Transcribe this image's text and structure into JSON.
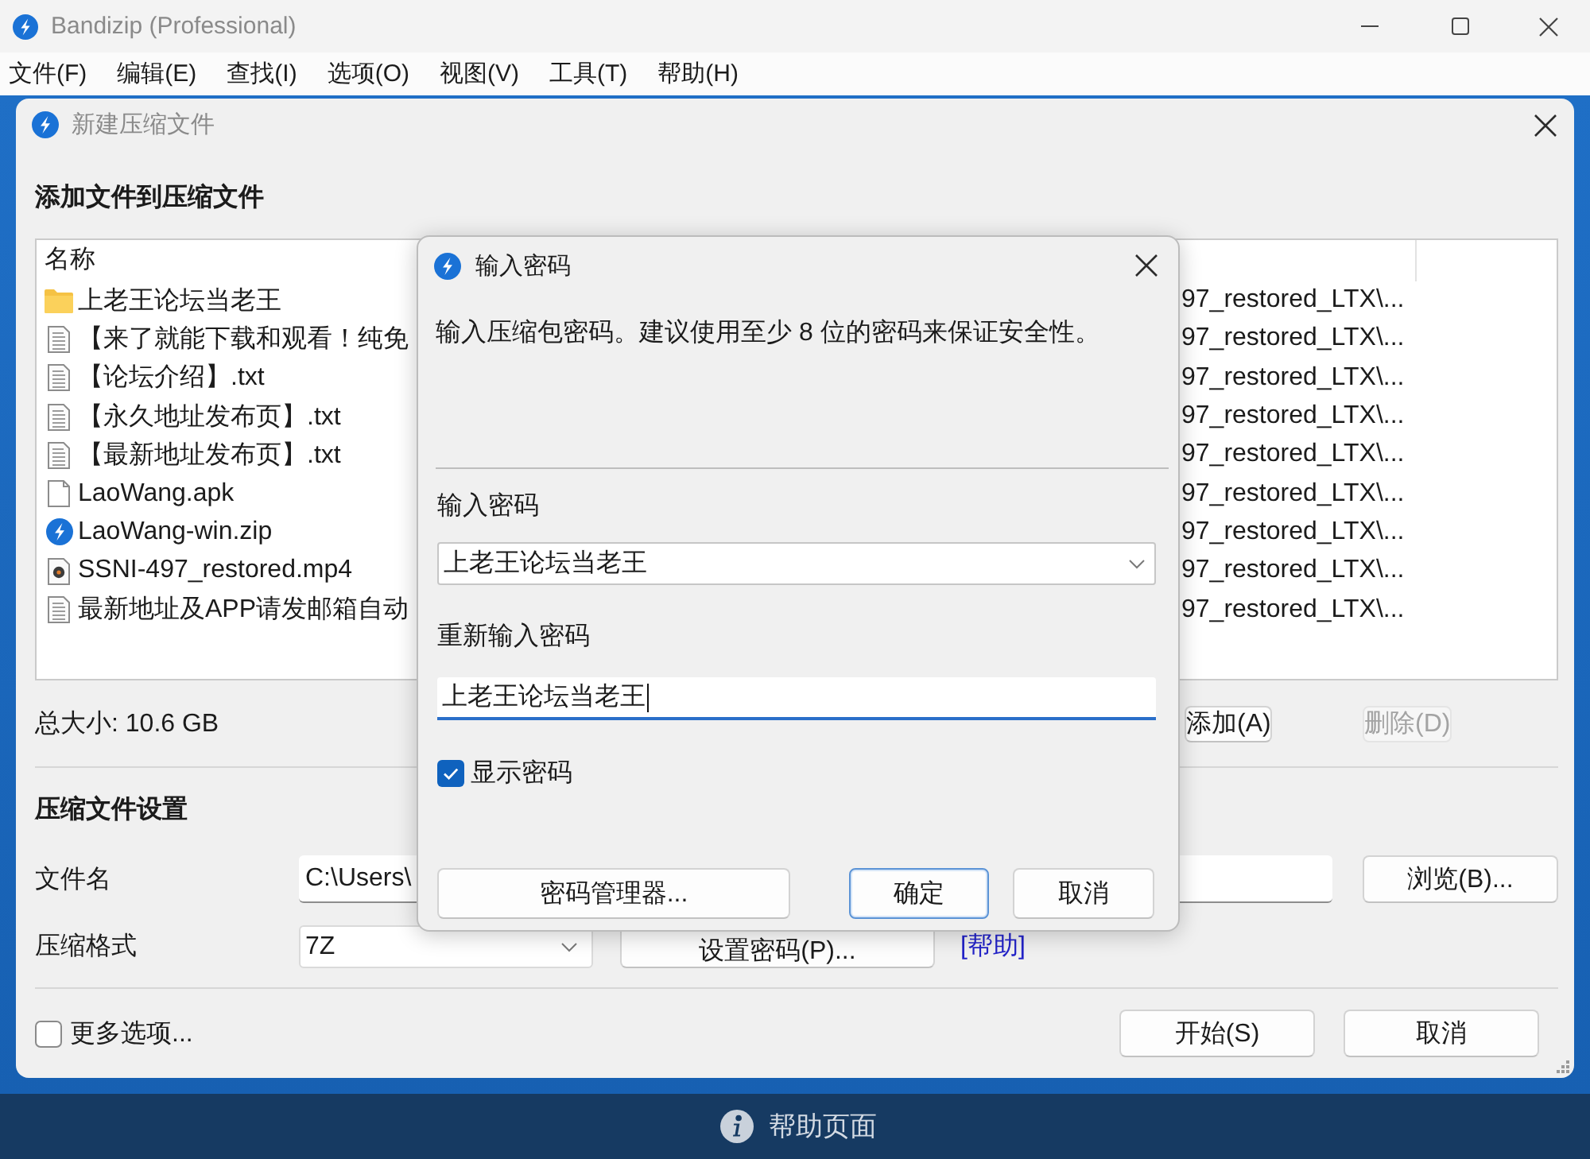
{
  "window": {
    "title": "Bandizip (Professional)"
  },
  "menu_bar": [
    "文件(F)",
    "编辑(E)",
    "查找(I)",
    "选项(O)",
    "视图(V)",
    "工具(T)",
    "帮助(H)"
  ],
  "new_archive_dialog": {
    "title": "新建压缩文件",
    "add_files_heading": "添加文件到压缩文件",
    "file_list": {
      "columns": [
        "名称"
      ],
      "rows": [
        {
          "kind": "folder",
          "name": "上老王论坛当老王",
          "column_2": "97_restored_LTX\\..."
        },
        {
          "kind": "text",
          "name": "【来了就能下载和观看！纯免",
          "column_2": "97_restored_LTX\\..."
        },
        {
          "kind": "text",
          "name": "【论坛介绍】.txt",
          "column_2": "97_restored_LTX\\..."
        },
        {
          "kind": "text",
          "name": "【永久地址发布页】.txt",
          "column_2": "97_restored_LTX\\..."
        },
        {
          "kind": "text",
          "name": "【最新地址发布页】.txt",
          "column_2": "97_restored_LTX\\..."
        },
        {
          "kind": "file",
          "name": "LaoWang.apk",
          "column_2": "97_restored_LTX\\..."
        },
        {
          "kind": "archive",
          "name": "LaoWang-win.zip",
          "column_2": "97_restored_LTX\\..."
        },
        {
          "kind": "video",
          "name": "SSNI-497_restored.mp4",
          "column_2": "97_restored_LTX\\..."
        },
        {
          "kind": "text",
          "name": "最新地址及APP请发邮箱自动",
          "column_2": "97_restored_LTX\\..."
        }
      ]
    },
    "total_size": "总大小: 10.6 GB",
    "add_button": {
      "label": "添加(A)",
      "disabled": false
    },
    "delete_button": {
      "label": "删除(D)",
      "disabled": true
    },
    "settings_heading": "压缩文件设置",
    "file_name": {
      "label": "文件名",
      "value": "C:\\Users\\"
    },
    "browse_button": "浏览(B)...",
    "format": {
      "label": "压缩格式",
      "value": "7Z"
    },
    "set_password_button": "设置密码(P)...",
    "help_link": "[帮助]",
    "more_options": {
      "label": "更多选项...",
      "checked": false
    },
    "buttons": [
      "开始(S)",
      "取消"
    ]
  },
  "password_dialog": {
    "title": "输入密码",
    "description": "输入压缩包密码。建议使用至少 8 位的密码来保证安全性。",
    "password": {
      "label": "输入密码",
      "value": "上老王论坛当老王"
    },
    "confirm_password": {
      "label": "重新输入密码",
      "value": "上老王论坛当老王"
    },
    "show_password": {
      "label": "显示密码",
      "checked": true
    },
    "buttons": [
      {
        "label": "密码管理器...",
        "default": false
      },
      {
        "label": "确定",
        "default": true
      },
      {
        "label": "取消",
        "default": false
      }
    ]
  },
  "help_bar": {
    "label": "帮助页面"
  }
}
